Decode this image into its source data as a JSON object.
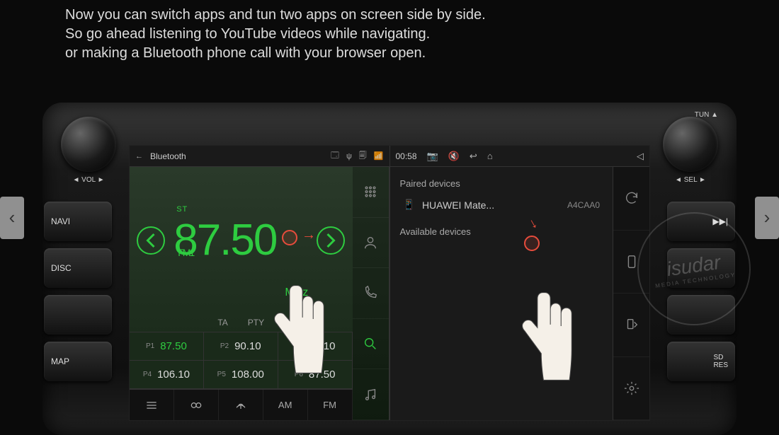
{
  "promo": {
    "line1": "Now you can switch apps and tun two apps on screen side by side.",
    "line2": "So go ahead listening to YouTube videos while navigating.",
    "line3": "or making a Bluetooth phone call with your browser open."
  },
  "hard_buttons": {
    "vol_label": "VOL",
    "tun_label": "TUN",
    "sel_label": "SEL",
    "left": [
      "NAVI",
      "DISC",
      "",
      "MAP"
    ],
    "right": [
      "▶▶|",
      "",
      "",
      "SD\nRES"
    ]
  },
  "left_app": {
    "statusbar": {
      "back_icon": "←",
      "title": "Bluetooth",
      "icons": [
        "🗔",
        "ψ",
        "🗐"
      ],
      "wifi": "📶"
    },
    "radio": {
      "st": "ST",
      "band": "FM1",
      "frequency": "87.50",
      "unit": "MHz",
      "modes": [
        "TA",
        "PTY"
      ],
      "presets": [
        {
          "n": "P1",
          "v": "87.50",
          "active": true
        },
        {
          "n": "P2",
          "v": "90.10"
        },
        {
          "n": "P3",
          "v": "98.10"
        },
        {
          "n": "P4",
          "v": "106.10"
        },
        {
          "n": "P5",
          "v": "108.00"
        },
        {
          "n": "P6",
          "v": "87.50"
        }
      ],
      "bottom": [
        "menu",
        "link",
        "broadcast",
        "AM",
        "FM"
      ]
    }
  },
  "right_app": {
    "statusbar": {
      "time": "00:58",
      "icons": [
        "📷",
        "🔇",
        "↩",
        "⌂",
        "◁"
      ]
    },
    "bt": {
      "paired_label": "Paired devices",
      "device": {
        "icon": "📱",
        "name": "HUAWEI Mate...",
        "mac": "A4CAA0"
      },
      "available_label": "Available devices"
    }
  },
  "watermark": {
    "brand": "isudar",
    "sub": "MEDIA TECHNOLOGY"
  }
}
